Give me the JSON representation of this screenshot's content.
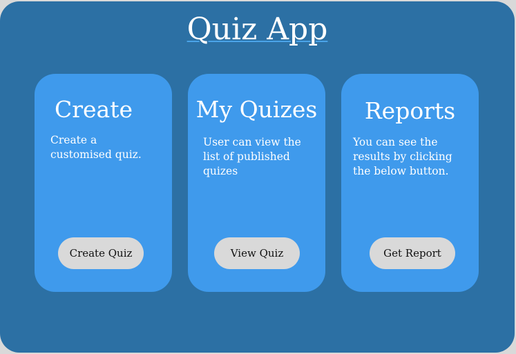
{
  "app": {
    "title": "Quiz App"
  },
  "cards": [
    {
      "title": "Create",
      "description": "Create a customised quiz.",
      "button_label": "Create Quiz"
    },
    {
      "title": "My Quizes",
      "description": "User can view the list of published quizes",
      "button_label": "View Quiz"
    },
    {
      "title": "Reports",
      "description": "You can see the results by clicking the below button.",
      "button_label": "Get Report"
    }
  ],
  "colors": {
    "page_background": "#d9d9d9",
    "panel_background": "#2c70a4",
    "card_background": "#3f9aec",
    "button_background": "#d9d9d9",
    "title_underline": "#4aa3e8"
  }
}
